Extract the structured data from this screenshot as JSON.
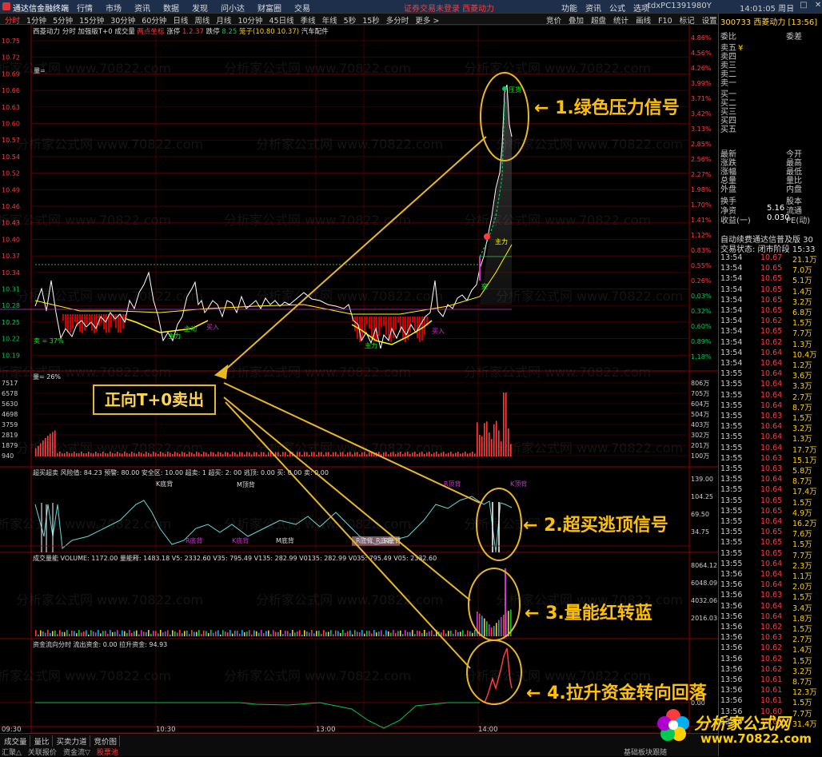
{
  "titlebar": {
    "app": "通达信金融终端",
    "menu": [
      "行情",
      "市场",
      "资讯",
      "数据",
      "发现",
      "问小达",
      "财富圈",
      "交易"
    ],
    "warning": "证券交易未登录  西菱动力",
    "right_menu": [
      "功能",
      "资讯",
      "公式",
      "选项"
    ],
    "account": "tdxPC1391980Y",
    "clock": "14:01:05 周日"
  },
  "toolbar": {
    "periods": [
      "分时",
      "1分钟",
      "5分钟",
      "15分钟",
      "30分钟",
      "60分钟",
      "日线",
      "周线",
      "月线",
      "10分钟",
      "45日线",
      "季线",
      "年线",
      "5秒",
      "15秒",
      "多分时",
      "更多 >"
    ],
    "right": [
      "竞价",
      "叠加",
      "超盘",
      "统计",
      "画线",
      "F10",
      "标记",
      "设置",
      "返回"
    ]
  },
  "main_panel": {
    "legend": [
      "西菱动力",
      "分时",
      "加强版T+0",
      "成交量",
      "两点坐标",
      "涨停",
      "1.2.37",
      "跌停",
      "8.25",
      "笼子(10.80 10.37)",
      "汽车配件"
    ],
    "price_ticks": [
      "10.75",
      "10.72",
      "10.69",
      "10.66",
      "10.63",
      "10.60",
      "10.57",
      "10.54",
      "10.52",
      "10.49",
      "10.46",
      "10.43",
      "10.40",
      "10.37",
      "10.34",
      "10.31",
      "10.28",
      "10.25",
      "10.22",
      "10.19"
    ],
    "pct_ticks": [
      "4.86%",
      "4.56%",
      "4.26%",
      "3.99%",
      "3.71%",
      "3.42%",
      "3.13%",
      "2.85%",
      "2.56%",
      "2.27%",
      "1.98%",
      "1.70%",
      "1.41%",
      "1.12%",
      "0.83%",
      "0.55%",
      "0.26%",
      "0.03%",
      "0.32%",
      "0.60%",
      "0.89%",
      "1.18%"
    ],
    "labels": {
      "sell": "卖 = 37%",
      "bottom_left": "量=",
      "pressure": "压货",
      "zhuli": "主力",
      "tu": "突",
      "buy1": "买入",
      "buy2": "买入",
      "zhuwei": "主动",
      "zhuwei2": "主力",
      "zhuwei3": "主力"
    }
  },
  "volume_panel": {
    "legend": "量= 26%",
    "ticks": [
      "7517",
      "6578",
      "5630",
      "4698",
      "3759",
      "2819",
      "1879",
      "940"
    ],
    "right_ticks": [
      "806万",
      "705万",
      "604万",
      "504万",
      "403万",
      "302万",
      "201万",
      "100万"
    ]
  },
  "osc_panel": {
    "legend": "超买超卖  风险值: 84.23  预警: 80.00  安全区: 10.00  超卖: 1 超买: 2: 00  逃顶: 0.00  买: 0.00  卖: 0.00",
    "ticks": [
      "139.00",
      "104.25",
      "69.50",
      "34.75"
    ],
    "labels": [
      "K底背",
      "M顶背",
      "R底背",
      "K底背",
      "M底背",
      "R底背",
      "R顶背",
      "R底背",
      "R底背",
      "K顶背"
    ]
  },
  "vol_energy_panel": {
    "legend": "成交量能  VOLUME: 1172.00  量能释: 1483.18  V5: 2332.60  V35: 795.49  V135: 282.99  V0135: 282.99  V035: 795.49  V05: 2332.60",
    "ticks": [
      "8064.12",
      "6048.09",
      "4032.06",
      "2016.03"
    ]
  },
  "fund_panel": {
    "legend": "资金流向分时  流出资金: 0.00  拉升资金: 94.93",
    "ticks": [
      "0.00"
    ]
  },
  "time_axis": [
    "09:30",
    "10:30",
    "13:00",
    "14:00"
  ],
  "bottom": {
    "tabs": [
      "成交量",
      "量比",
      "买卖力道",
      "竞价图"
    ],
    "row2": [
      "汇聚△",
      "关联报价",
      "资金流▽",
      "股票池"
    ],
    "right": "基础板块跟随"
  },
  "annotations": {
    "c1": "← 1.绿色压力信号",
    "c2": "← 2.超买逃顶信号",
    "c3": "← 3.量能红转蓝",
    "c4": "← 4.拉升资金转向回落",
    "box": "正向T+0卖出"
  },
  "right_panel": {
    "header": "300733 西菱动力 [13:56]",
    "weibi": "委比",
    "weicha": "委差",
    "asks": [
      "卖五",
      "卖四",
      "卖三",
      "卖二",
      "卖一"
    ],
    "bids": [
      "买一",
      "买二",
      "买三",
      "买四",
      "买五"
    ],
    "stats_left": [
      "最新",
      "涨跌",
      "涨幅",
      "总量",
      "外盘"
    ],
    "stats_right": [
      "今开",
      "最高",
      "最低",
      "量比",
      "内盘"
    ],
    "stats_a": [
      {
        "l": "换手",
        "r": "股本"
      },
      {
        "l": "净资",
        "v": "5.16",
        "r": "流通"
      },
      {
        "l": "收益(一)",
        "v": "0.030",
        "r": "PE(动)"
      }
    ],
    "ticker1": "自动续费通达信普及版 30",
    "ticker2": "交易状态: 闭市阶段  15:33",
    "ask_mark": "¥",
    "trades": [
      [
        "13:54",
        "10.67",
        "21.1万"
      ],
      [
        "13:54",
        "10.65",
        "7.0万"
      ],
      [
        "13:54",
        "10.65",
        "5.1万"
      ],
      [
        "13:54",
        "10.65",
        "1.4万"
      ],
      [
        "13:54",
        "10.65",
        "3.2万"
      ],
      [
        "13:54",
        "10.65",
        "6.8万"
      ],
      [
        "13:54",
        "10.62",
        "1.5万"
      ],
      [
        "13:54",
        "10.65",
        "7.7万"
      ],
      [
        "13:54",
        "10.62",
        "1.3万"
      ],
      [
        "13:54",
        "10.64",
        "10.4万"
      ],
      [
        "13:54",
        "10.64",
        "1.2万"
      ],
      [
        "13:55",
        "10.64",
        "3.6万"
      ],
      [
        "13:55",
        "10.64",
        "3.3万"
      ],
      [
        "13:55",
        "10.64",
        "2.7万"
      ],
      [
        "13:55",
        "10.64",
        "8.7万"
      ],
      [
        "13:55",
        "10.63",
        "1.5万"
      ],
      [
        "13:55",
        "10.64",
        "3.2万"
      ],
      [
        "13:55",
        "10.64",
        "1.3万"
      ],
      [
        "13:55",
        "10.64",
        "17.7万"
      ],
      [
        "13:55",
        "10.63",
        "15.1万"
      ],
      [
        "13:55",
        "10.63",
        "5.8万"
      ],
      [
        "13:55",
        "10.64",
        "8.7万"
      ],
      [
        "13:55",
        "10.64",
        "17.4万"
      ],
      [
        "13:55",
        "10.65",
        "1.5万"
      ],
      [
        "13:55",
        "10.65",
        "4.9万"
      ],
      [
        "13:55",
        "10.64",
        "16.2万"
      ],
      [
        "13:55",
        "10.65",
        "7.6万"
      ],
      [
        "13:55",
        "10.65",
        "1.5万"
      ],
      [
        "13:55",
        "10.65",
        "7.7万"
      ],
      [
        "13:55",
        "10.64",
        "2.3万"
      ],
      [
        "13:56",
        "10.64",
        "1.1万"
      ],
      [
        "13:56",
        "10.64",
        "2.0万"
      ],
      [
        "13:56",
        "10.63",
        "1.5万"
      ],
      [
        "13:56",
        "10.64",
        "3.4万"
      ],
      [
        "13:56",
        "10.64",
        "1.8万"
      ],
      [
        "13:56",
        "10.62",
        "1.5万"
      ],
      [
        "13:56",
        "10.63",
        "2.7万"
      ],
      [
        "13:56",
        "10.62",
        "1.4万"
      ],
      [
        "13:56",
        "10.62",
        "1.5万"
      ],
      [
        "13:56",
        "10.62",
        "3.2万"
      ],
      [
        "13:56",
        "10.61",
        "8.7万"
      ],
      [
        "13:56",
        "10.61",
        "12.3万"
      ],
      [
        "13:56",
        "10.61",
        "1.5万"
      ],
      [
        "13:56",
        "10.60",
        "7.7万"
      ],
      [
        "13:56",
        "10.60",
        "31.4万"
      ]
    ]
  },
  "logo": {
    "brand": "分析家公式网",
    "url": "www.70822.com"
  },
  "watermark": "分析家公式网 www.70822.com",
  "colors": {
    "up": "#ff3b3b",
    "down": "#00d26a",
    "grid": "#8b0000",
    "accent": "#ffc000",
    "price_line": "#ffffff",
    "avg_line": "#ffff00"
  }
}
